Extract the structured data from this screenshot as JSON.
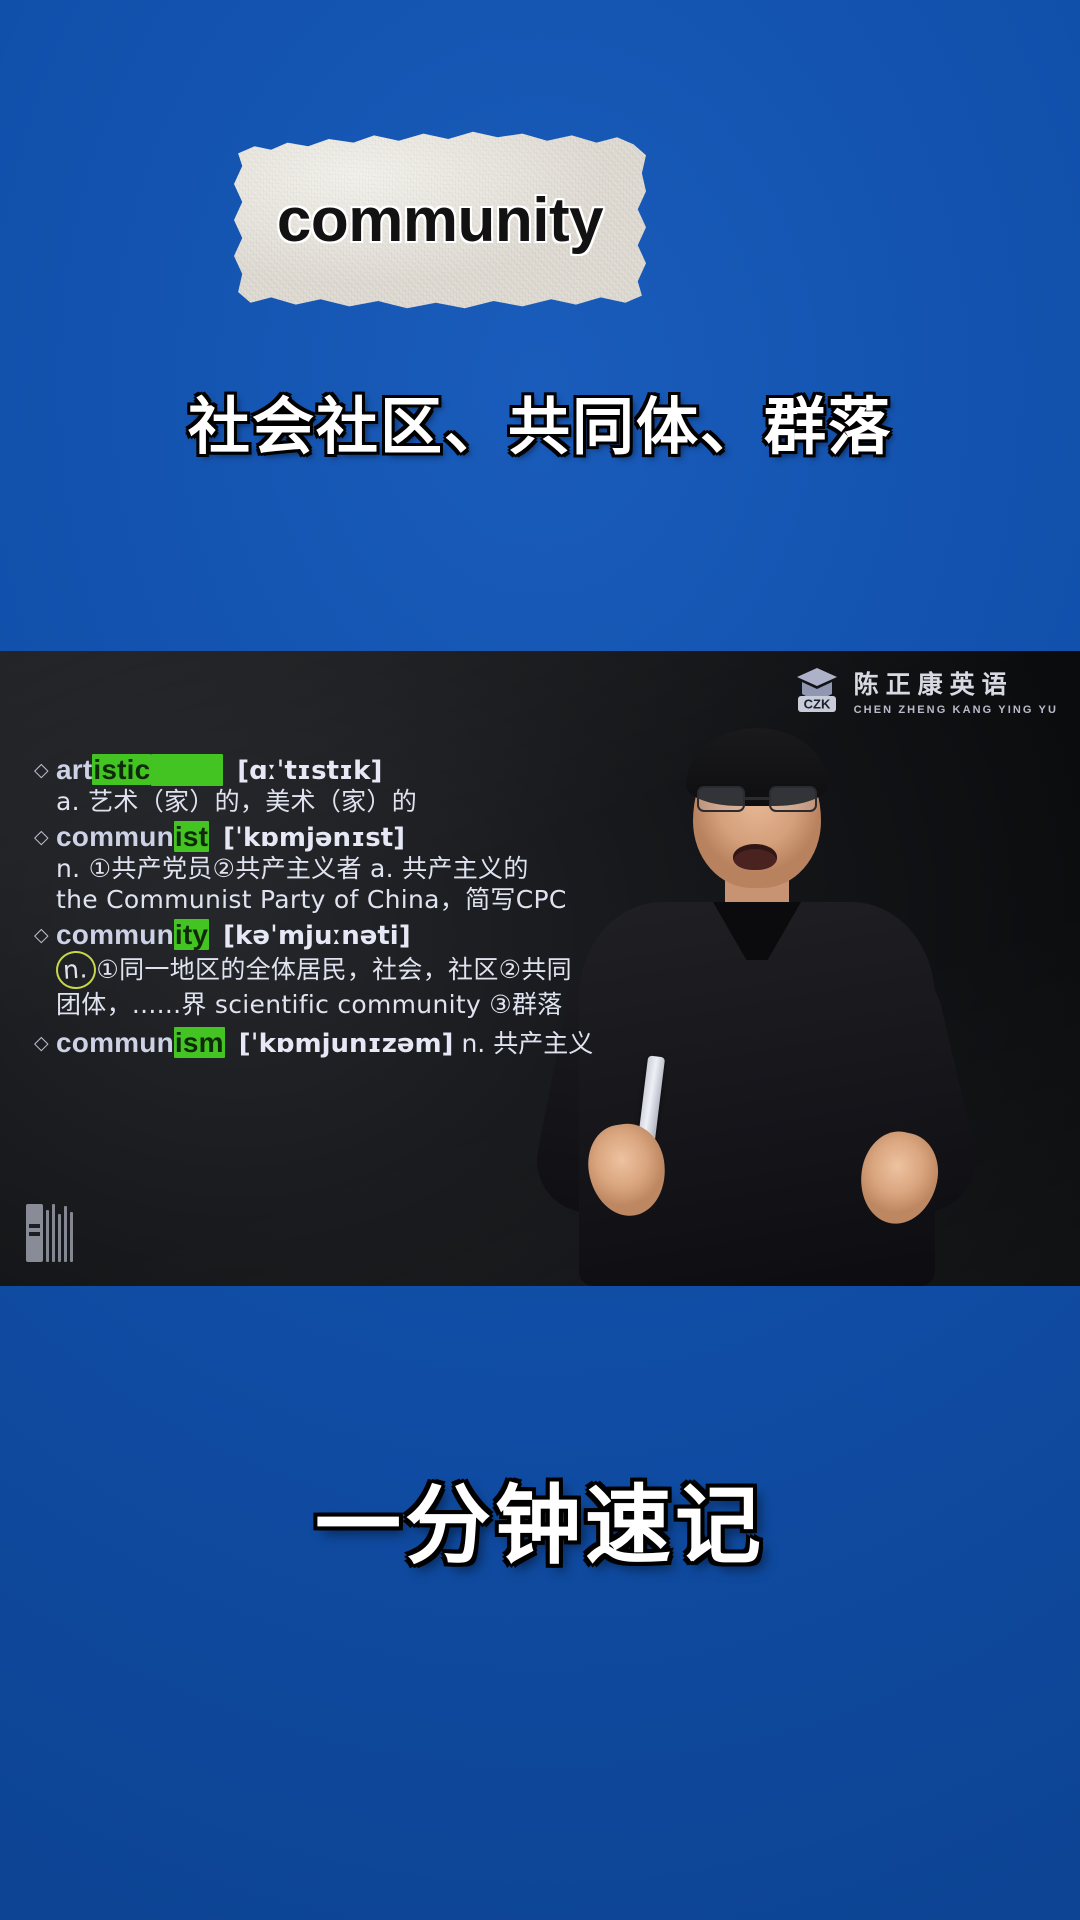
{
  "background": {
    "color": "#1150ab"
  },
  "headline_card": {
    "word": "community",
    "paper_color": "#e6e3dc"
  },
  "meaning_line": "社会社区、共同体、群落",
  "video": {
    "brand": {
      "logo_text": "CZK",
      "name_cn": "陈正康英语",
      "name_en": "CHEN ZHENG KANG YING YU"
    },
    "highlight_color": "#44c423",
    "circle_color": "#c8d64a",
    "vocab": [
      {
        "bullet": "diamond-icon",
        "term_prefix": "art",
        "term_highlight": "istic",
        "term_suffix": "",
        "phonetic": "[ɑːˈtɪstɪk]",
        "definitions": [
          "a. 艺术（家）的，美术（家）的"
        ],
        "tail": "",
        "circled": ""
      },
      {
        "bullet": "diamond-icon",
        "term_prefix": "commun",
        "term_highlight": "ist",
        "term_suffix": "",
        "phonetic": "[ˈkɒmjənɪst]",
        "definitions": [
          "n. ①共产党员②共产主义者 a. 共产主义的",
          "the Communist Party of China，简写CPC"
        ],
        "tail": "",
        "circled": ""
      },
      {
        "bullet": "diamond-icon",
        "term_prefix": "commun",
        "term_highlight": "ity",
        "term_suffix": "",
        "phonetic": "[kəˈmjuːnəti]",
        "definitions": [
          "①同一地区的全体居民，社会，社区②共同",
          "团体，......界 scientific community ③群落"
        ],
        "tail": "",
        "circled": "n."
      },
      {
        "bullet": "diamond-icon",
        "term_prefix": "commun",
        "term_highlight": "ism",
        "term_suffix": "",
        "phonetic": "[ˈkɒmjunɪzəm]",
        "definitions": [],
        "tail": "n. 共产主义",
        "circled": ""
      }
    ]
  },
  "bottom_caption": "一分钟速记"
}
